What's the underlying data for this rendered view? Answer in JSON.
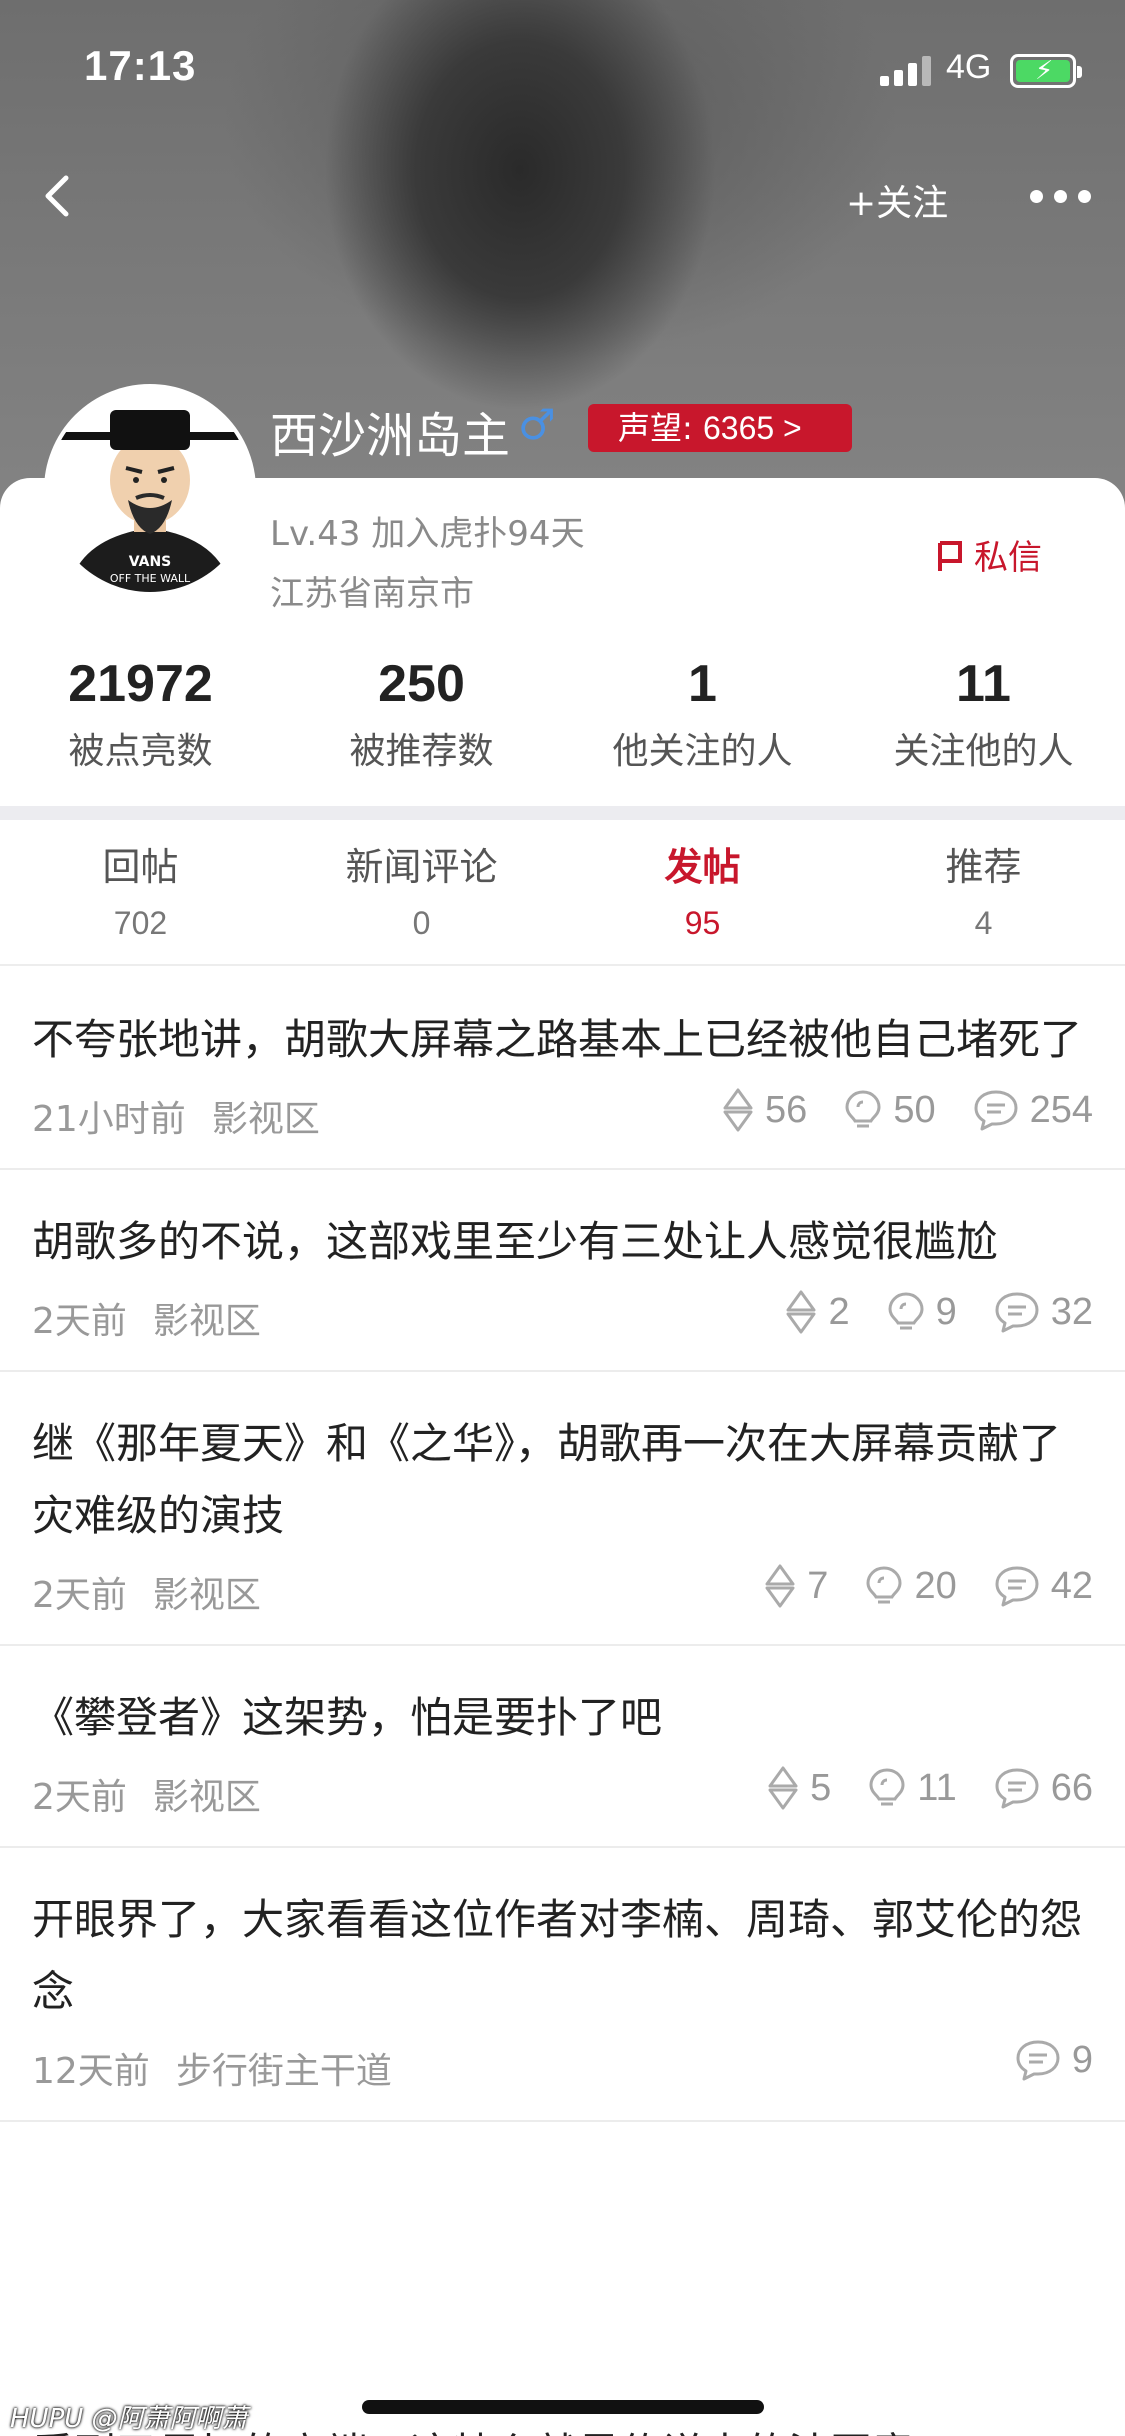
{
  "status_bar": {
    "time": "17:13",
    "network": "4G",
    "battery_level": 0.8,
    "battery_color": "#4cd964"
  },
  "nav": {
    "back_icon": "chevron-left-icon",
    "follow_label": "+关注",
    "more_icon": "more-dots-icon"
  },
  "profile": {
    "name": "西沙洲岛主",
    "gender_symbol": "♂",
    "reputation_label": "声望:",
    "reputation_value": "6365 >",
    "level_info": "Lv.43 加入虎扑94天",
    "location": "江苏省南京市",
    "message_label": "私信"
  },
  "stats": [
    {
      "value": "21972",
      "label": "被点亮数"
    },
    {
      "value": "250",
      "label": "被推荐数"
    },
    {
      "value": "1",
      "label": "他关注的人"
    },
    {
      "value": "11",
      "label": "关注他的人"
    }
  ],
  "tabs": [
    {
      "label": "回帖",
      "count": "702",
      "active": false
    },
    {
      "label": "新闻评论",
      "count": "0",
      "active": false
    },
    {
      "label": "发帖",
      "count": "95",
      "active": true
    },
    {
      "label": "推荐",
      "count": "4",
      "active": false
    }
  ],
  "posts": [
    {
      "title": "不夸张地讲，胡歌大屏幕之路基本上已经被他自己堵死了",
      "time": "21小时前",
      "zone": "影视区",
      "rec": "56",
      "light": "50",
      "reply": "254"
    },
    {
      "title": "胡歌多的不说，这部戏里至少有三处让人感觉很尴尬",
      "time": "2天前",
      "zone": "影视区",
      "rec": "2",
      "light": "9",
      "reply": "32"
    },
    {
      "title": "继《那年夏天》和《之华》，胡歌再一次在大屏幕贡献了灾难级的演技",
      "time": "2天前",
      "zone": "影视区",
      "rec": "7",
      "light": "20",
      "reply": "42"
    },
    {
      "title": "《攀登者》这架势，怕是要扑了吧",
      "time": "2天前",
      "zone": "影视区",
      "rec": "5",
      "light": "11",
      "reply": "66"
    },
    {
      "title": "开眼界了，大家看看这位作者对李楠、周琦、郭艾伦的怨念",
      "time": "12天前",
      "zone": "步行街主干道",
      "rec": "",
      "light": "",
      "reply": "9"
    }
  ],
  "partial_next_post": "看到了足坛的高端，这特么就是传说中的法国童",
  "watermark": "HUPU @阿萧阿啊萧",
  "accent_color": "#c8172c"
}
